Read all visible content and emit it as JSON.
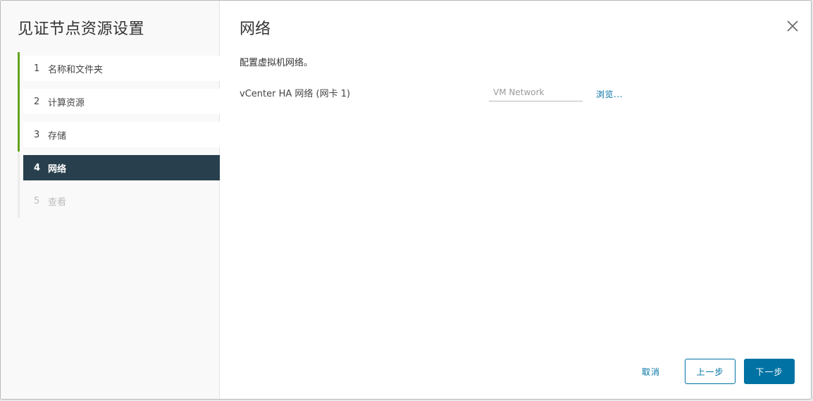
{
  "sidebar": {
    "title": "见证节点资源设置",
    "steps": [
      {
        "num": "1",
        "label": "名称和文件夹"
      },
      {
        "num": "2",
        "label": "计算资源"
      },
      {
        "num": "3",
        "label": "存储"
      },
      {
        "num": "4",
        "label": "网络"
      },
      {
        "num": "5",
        "label": "查看"
      }
    ]
  },
  "content": {
    "title": "网络",
    "description": "配置虚拟机网络。",
    "field_label": "vCenter HA 网络 (网卡 1)",
    "field_placeholder": "VM Network",
    "browse_label": "浏览..."
  },
  "footer": {
    "cancel_label": "取消",
    "back_label": "上一步",
    "next_label": "下一步"
  },
  "colors": {
    "accent": "#0072a3",
    "active_step_bg": "#28404d",
    "completed_step_bar": "#62a420"
  },
  "icons": {
    "close": "close-icon"
  }
}
